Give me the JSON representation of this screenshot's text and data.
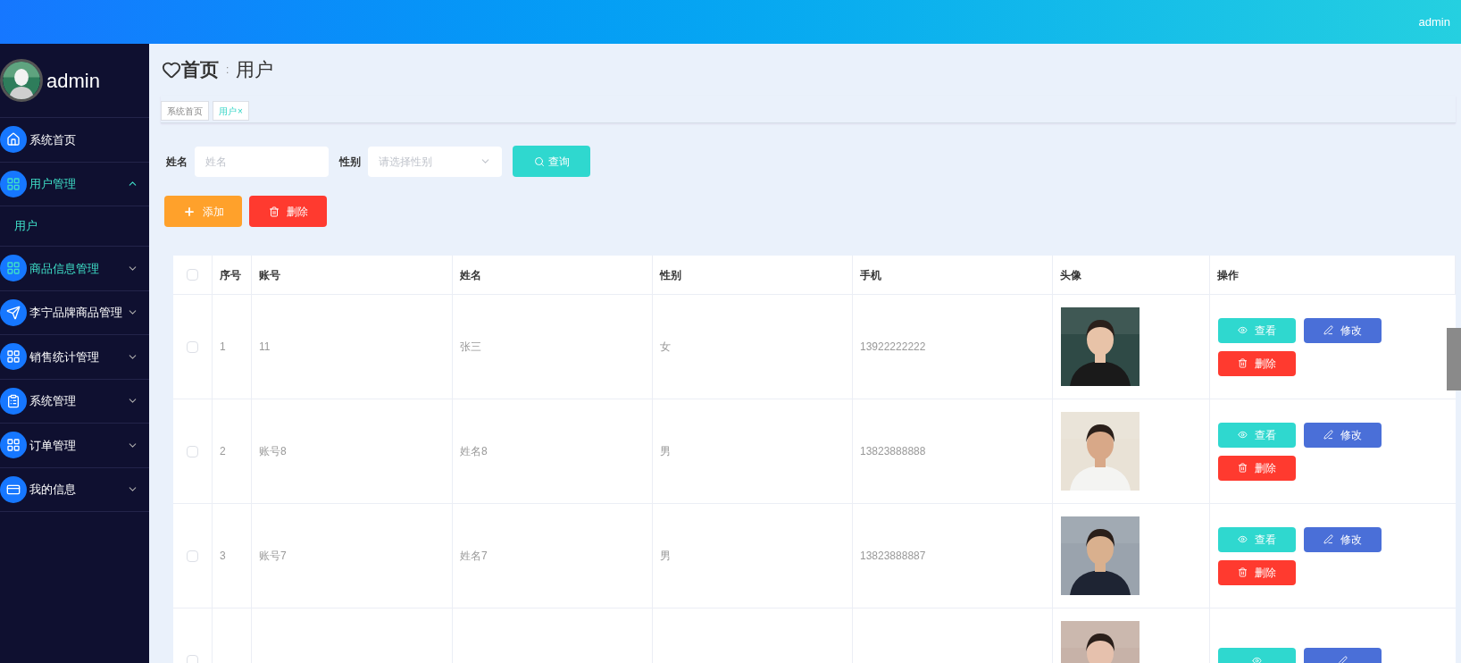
{
  "header": {
    "user": "admin"
  },
  "sidebar": {
    "user": "admin",
    "items": [
      {
        "kind": "home",
        "label": "系统首页",
        "highlighted": false
      },
      {
        "kind": "grid",
        "label": "用户管理",
        "highlighted": true,
        "expanded": true,
        "children": [
          {
            "label": "用户",
            "selected": true
          }
        ]
      },
      {
        "kind": "grid",
        "label": "商品信息管理",
        "highlighted": true,
        "expanded": false
      },
      {
        "kind": "send",
        "label": "李宁品牌商品管理",
        "highlighted": false,
        "expanded": false
      },
      {
        "kind": "grid",
        "label": "销售统计管理",
        "highlighted": false,
        "expanded": false
      },
      {
        "kind": "clipboard",
        "label": "系统管理",
        "highlighted": false,
        "expanded": false
      },
      {
        "kind": "grid",
        "label": "订单管理",
        "highlighted": false,
        "expanded": false
      },
      {
        "kind": "card",
        "label": "我的信息",
        "highlighted": false,
        "expanded": false
      }
    ]
  },
  "breadcrumb": {
    "home": "首页",
    "separator": ":",
    "current": "用户"
  },
  "tabs": [
    {
      "label": "系统首页",
      "selected": false,
      "closable": false
    },
    {
      "label": "用户",
      "selected": true,
      "closable": true,
      "close": "×"
    }
  ],
  "search": {
    "fields": [
      {
        "kind": "input",
        "label": "姓名",
        "placeholder": "姓名"
      },
      {
        "kind": "select",
        "label": "性别",
        "placeholder": "请选择性别"
      }
    ],
    "button": "查询"
  },
  "actions": [
    {
      "kind": "add",
      "label": "添加"
    },
    {
      "kind": "delete",
      "label": "删除"
    }
  ],
  "table": {
    "select_all_checked": false,
    "columns": [
      "序号",
      "账号",
      "姓名",
      "性别",
      "手机",
      "头像",
      "操作"
    ],
    "rows": [
      {
        "checked": false,
        "index": "1",
        "account": "11",
        "name": "张三",
        "gender": "女",
        "phone": "13922222222",
        "avatar": {
          "kind": "picture"
        },
        "buttons": [
          {
            "kind": "view",
            "label": "查看"
          },
          {
            "kind": "edit",
            "label": "修改"
          },
          {
            "kind": "delete",
            "label": "删除"
          }
        ]
      },
      {
        "checked": false,
        "index": "2",
        "account": "账号8",
        "name": "姓名8",
        "gender": "男",
        "phone": "13823888888",
        "avatar": {
          "kind": "picture"
        },
        "buttons": [
          {
            "kind": "view",
            "label": "查看"
          },
          {
            "kind": "edit",
            "label": "修改"
          },
          {
            "kind": "delete",
            "label": "删除"
          }
        ]
      },
      {
        "checked": false,
        "index": "3",
        "account": "账号7",
        "name": "姓名7",
        "gender": "男",
        "phone": "13823888887",
        "avatar": {
          "kind": "picture"
        },
        "buttons": [
          {
            "kind": "view",
            "label": "查看"
          },
          {
            "kind": "edit",
            "label": "修改"
          },
          {
            "kind": "delete",
            "label": "删除"
          }
        ]
      },
      {
        "checked": false,
        "avatar": {
          "kind": "picture"
        },
        "buttons": [
          {
            "kind": "view"
          },
          {
            "kind": "edit"
          }
        ]
      }
    ]
  }
}
